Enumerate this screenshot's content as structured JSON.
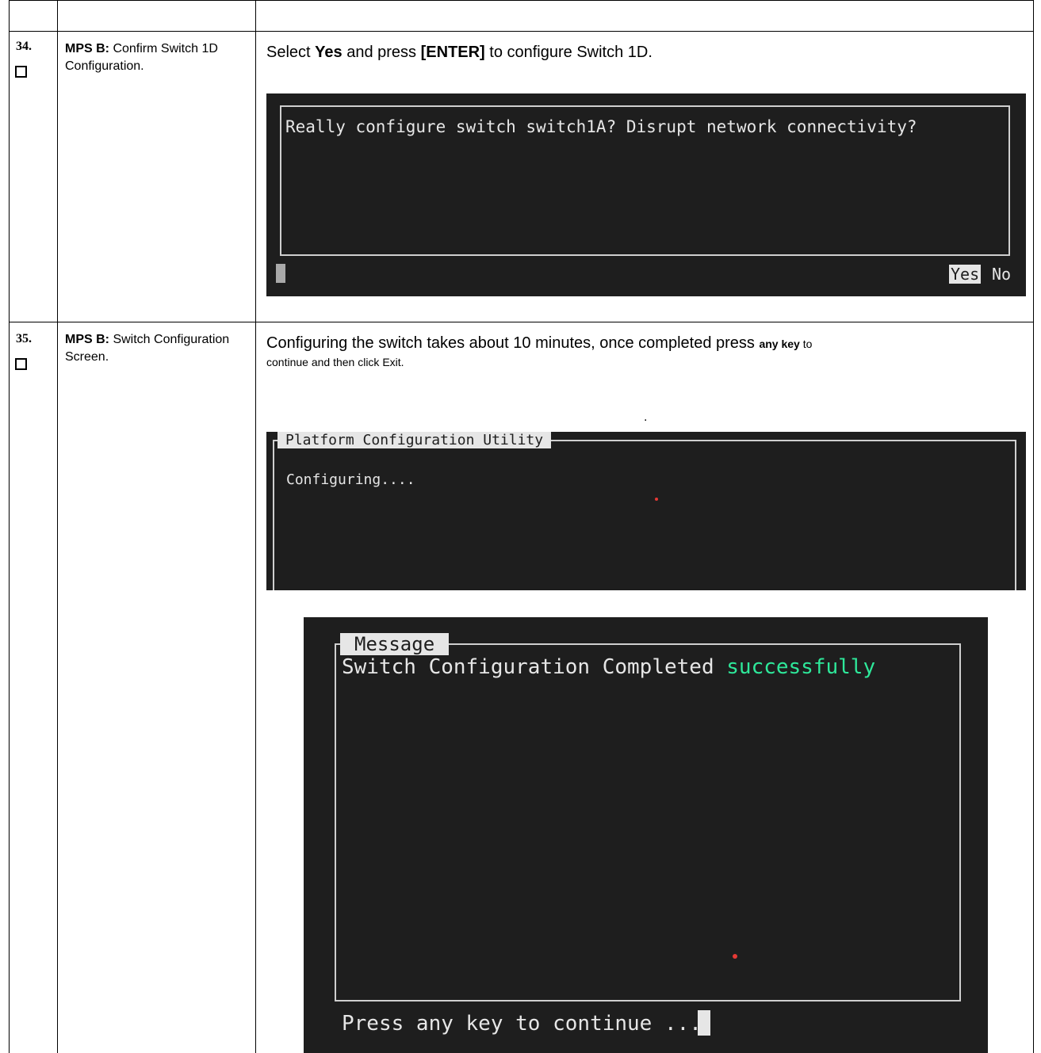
{
  "rows": [
    {
      "number": "34.",
      "label_bold": "MPS B:",
      "label_rest": " Confirm Switch 1D Configuration.",
      "instruction": {
        "pre": "Select ",
        "bold1": "Yes",
        "mid": " and press ",
        "bold2": "[ENTER]",
        "post": " to configure Switch 1D."
      },
      "terminal": {
        "question": "Really configure switch switch1A? Disrupt network connectivity?",
        "yes": "Yes",
        "no": "No"
      }
    },
    {
      "number": "35.",
      "label_bold": "MPS B:",
      "label_rest": " Switch Configuration Screen.",
      "instruction": {
        "line1_pre": "Configuring the switch takes about 10 minutes, once completed press ",
        "line1_bold": "any key",
        "line1_post": " to",
        "line2": "continue and then click Exit."
      },
      "dot_text": ".",
      "terminal_pcu": {
        "title": "Platform Configuration Utility",
        "status": "Configuring...."
      },
      "terminal_msg": {
        "title": "Message",
        "text_pre": "Switch Configuration Completed ",
        "text_success": "successfully",
        "prompt": "Press any key to continue ..."
      }
    }
  ],
  "colors": {
    "terminal_bg": "#1e1e1e",
    "terminal_text": "#e6e6e6",
    "success": "#2ee89a",
    "border": "#cfcfcf"
  }
}
